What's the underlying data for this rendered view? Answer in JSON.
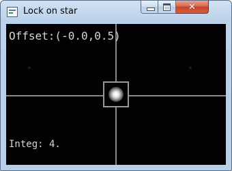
{
  "window": {
    "title": "Lock on star",
    "icon": "app-window-icon",
    "controls": {
      "minimize": "minimize-icon",
      "maximize": "maximize-icon",
      "close_glyph": "✕"
    }
  },
  "view": {
    "offset_label": "Offset:(-0.0,0.5)",
    "integ_label": "Integ: 4.",
    "colors": {
      "background": "#020202",
      "crosshair": "#8a8a8a",
      "text": "#d6d6d6"
    }
  }
}
